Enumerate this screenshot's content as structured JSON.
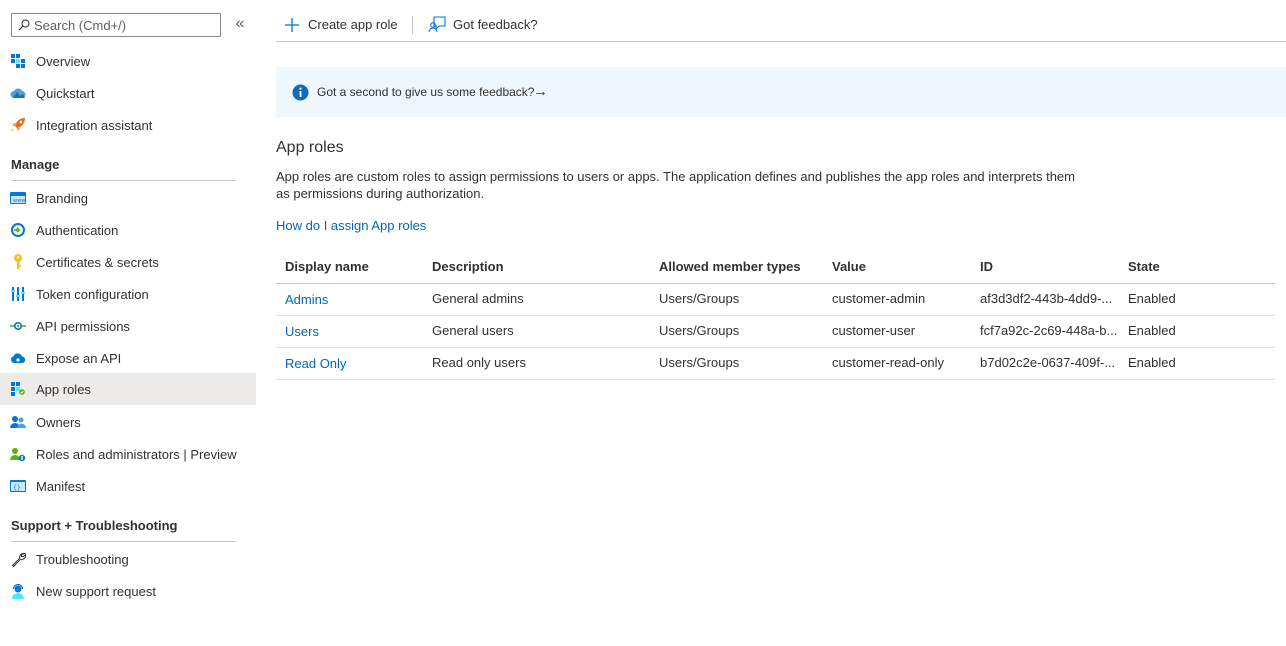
{
  "search": {
    "placeholder": "Search (Cmd+/)"
  },
  "sidebar": {
    "collapse_glyph": "«",
    "top_items": [
      {
        "label": "Overview",
        "icon": "overview-icon"
      },
      {
        "label": "Quickstart",
        "icon": "quickstart-icon"
      },
      {
        "label": "Integration assistant",
        "icon": "rocket-icon"
      }
    ],
    "manage_heading": "Manage",
    "manage_items": [
      {
        "label": "Branding",
        "icon": "branding-icon"
      },
      {
        "label": "Authentication",
        "icon": "authentication-icon"
      },
      {
        "label": "Certificates & secrets",
        "icon": "key-icon"
      },
      {
        "label": "Token configuration",
        "icon": "token-config-icon"
      },
      {
        "label": "API permissions",
        "icon": "api-permissions-icon"
      },
      {
        "label": "Expose an API",
        "icon": "cloud-icon"
      },
      {
        "label": "App roles",
        "icon": "app-roles-icon",
        "active": true
      },
      {
        "label": "Owners",
        "icon": "owners-icon"
      },
      {
        "label": "Roles and administrators | Preview",
        "icon": "roles-admins-icon"
      },
      {
        "label": "Manifest",
        "icon": "manifest-icon"
      }
    ],
    "support_heading": "Support + Troubleshooting",
    "support_items": [
      {
        "label": "Troubleshooting",
        "icon": "wrench-icon"
      },
      {
        "label": "New support request",
        "icon": "support-request-icon"
      }
    ]
  },
  "toolbar": {
    "create_label": "Create app role",
    "feedback_label": "Got feedback?"
  },
  "banner": {
    "text": "Got a second to give us some feedback?",
    "arrow": "→"
  },
  "main": {
    "title": "App roles",
    "description": "App roles are custom roles to assign permissions to users or apps. The application defines and publishes the app roles and interprets them as permissions during authorization.",
    "help_link": "How do I assign App roles"
  },
  "table": {
    "columns": [
      "Display name",
      "Description",
      "Allowed member types",
      "Value",
      "ID",
      "State"
    ],
    "rows": [
      [
        "Admins",
        "General admins",
        "Users/Groups",
        "customer-admin",
        "af3d3df2-443b-4dd9-...",
        "Enabled"
      ],
      [
        "Users",
        "General users",
        "Users/Groups",
        "customer-user",
        "fcf7a92c-2c69-448a-b...",
        "Enabled"
      ],
      [
        "Read Only",
        "Read only users",
        "Users/Groups",
        "customer-read-only",
        "b7d02c2e-0637-409f-...",
        "Enabled"
      ]
    ]
  },
  "colors": {
    "accent": "#0067b8",
    "banner_bg": "#eff6fc",
    "active_bg": "#edebe9"
  }
}
